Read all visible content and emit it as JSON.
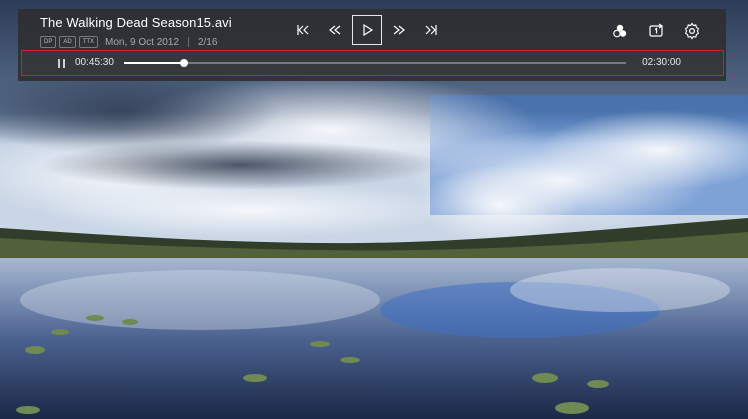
{
  "player": {
    "title": "The Walking Dead Season15.avi",
    "badges": [
      "DP",
      "AD",
      "TTX"
    ],
    "date": "Mon, 9 Oct 2012",
    "episode": "2/16"
  },
  "transport": {
    "buttons": [
      "skip-previous-icon",
      "rewind-icon",
      "play-icon",
      "fast-forward-icon",
      "skip-next-icon"
    ],
    "active": "play-icon"
  },
  "tools": [
    "picture-mode-icon",
    "repeat-one-icon",
    "settings-icon"
  ],
  "progress": {
    "current_time": "00:45:30",
    "total_time": "02:30:00",
    "fraction": 0.12
  },
  "colors": {
    "highlight_border": "#d11f28",
    "panel": "#2e2e30"
  }
}
